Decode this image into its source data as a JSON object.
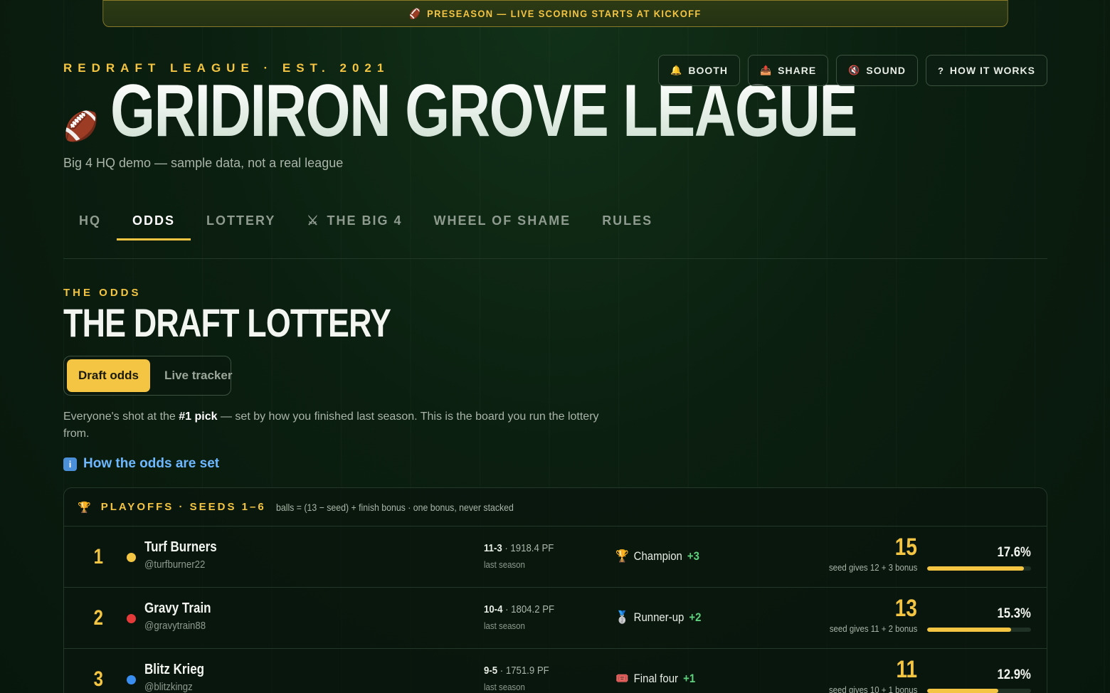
{
  "banner": {
    "icon": "football-icon",
    "text": "PRESEASON — LIVE SCORING STARTS AT KICKOFF"
  },
  "header": {
    "eyebrow": "REDRAFT LEAGUE · EST. 2021",
    "title": "GRIDIRON GROVE LEAGUE",
    "subtitle": "Big 4 HQ demo — sample data, not a real league"
  },
  "toolbar": {
    "booth": "BOOTH",
    "share": "SHARE",
    "sound": "SOUND",
    "how_it_works": "HOW IT WORKS"
  },
  "nav": {
    "tabs": [
      {
        "label": "HQ"
      },
      {
        "label": "ODDS"
      },
      {
        "label": "LOTTERY"
      },
      {
        "label": "THE BIG 4"
      },
      {
        "label": "WHEEL OF SHAME"
      },
      {
        "label": "RULES"
      }
    ],
    "active": "ODDS"
  },
  "section": {
    "eyebrow": "THE ODDS",
    "title": "THE DRAFT LOTTERY",
    "segments": [
      "Draft odds",
      "Live tracker"
    ],
    "desc_pre": "Everyone's shot at the ",
    "desc_bold": "#1 pick",
    "desc_post": " — set by how you finished last season. This is the board you run the lottery from.",
    "how_link": "How the odds are set"
  },
  "panel": {
    "title": "PLAYOFFS · SEEDS 1–6",
    "note": "balls = (13 − seed) + finish bonus · one bonus, never stacked",
    "rows": [
      {
        "seed": "1",
        "dot_color": "#f4c542",
        "name": "Turf Burners",
        "handle": "@turfburner22",
        "record": "11-3",
        "pf": " · 1918.4 PF",
        "record_sub": "last season",
        "finish_icon": "🏆",
        "finish": "Champion",
        "bonus": "+3",
        "balls": "15",
        "balls_sub": "seed gives 12 + 3 bonus",
        "pct": "17.6%",
        "pct_value": 17.6
      },
      {
        "seed": "2",
        "dot_color": "#e53a3a",
        "name": "Gravy Train",
        "handle": "@gravytrain88",
        "record": "10-4",
        "pf": " · 1804.2 PF",
        "record_sub": "last season",
        "finish_icon": "🥈",
        "finish": "Runner-up",
        "bonus": "+2",
        "balls": "13",
        "balls_sub": "seed gives 11 + 2 bonus",
        "pct": "15.3%",
        "pct_value": 15.3
      },
      {
        "seed": "3",
        "dot_color": "#3a8ef0",
        "name": "Blitz Krieg",
        "handle": "@blitzkingz",
        "record": "9-5",
        "pf": " · 1751.9 PF",
        "record_sub": "last season",
        "finish_icon": "🎟️",
        "finish": "Final four",
        "bonus": "+1",
        "balls": "11",
        "balls_sub": "seed gives 10 + 1 bonus",
        "pct": "12.9%",
        "pct_value": 12.9
      }
    ]
  },
  "colors": {
    "accent": "#f4c542",
    "link": "#6db8ff",
    "bonus": "#5fd07e",
    "bg": "#0b1f10"
  }
}
